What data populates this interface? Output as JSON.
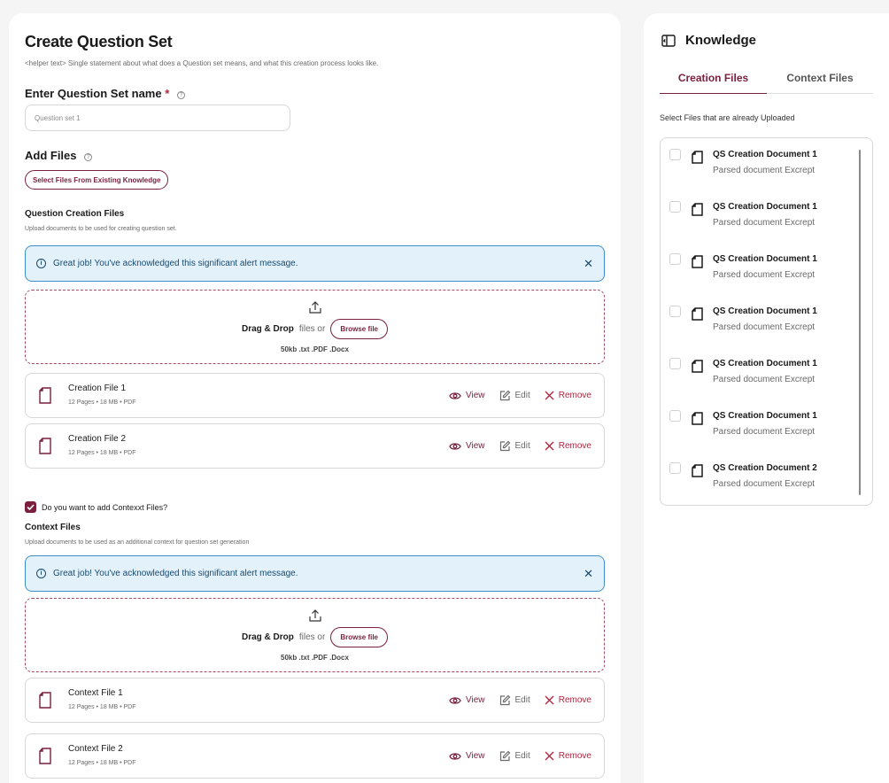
{
  "main": {
    "title": "Create Question Set",
    "helper": "<helper text> Single statement about what does a Question set  means, and what this creation process looks like.",
    "name_label": "Enter Question Set name",
    "required_mark": "*",
    "name_value": "Question set 1",
    "add_files_label": "Add Files",
    "select_existing_btn": "Select Files From Existing Knowledge",
    "creation_section": {
      "title": "Question Creation Files",
      "subtitle": "Upload documents to be used for creating question set.",
      "alert": "Great job! You've acknowledged this significant alert message.",
      "drop_label": "Drag & Drop",
      "drop_or": "files or",
      "browse": "Browse file",
      "formats": "50kb .txt .PDF .Docx",
      "files": [
        {
          "name": "Creation File 1",
          "meta": "12 Pages  •  18 MB  •  PDF"
        },
        {
          "name": "Creation File 2",
          "meta": "12 Pages  •  18 MB  •  PDF"
        }
      ]
    },
    "context_checkbox": "Do you want to add Contexxt Files?",
    "context_section": {
      "title": "Context Files",
      "subtitle": "Upload documents to be used as an additional context for question set generation",
      "alert": "Great job! You've acknowledged this significant alert message.",
      "drop_label": "Drag & Drop",
      "drop_or": "files or",
      "browse": "Browse file",
      "formats": "50kb .txt .PDF .Docx",
      "files": [
        {
          "name": "Context File 1",
          "meta": "12 Pages  •  18 MB  •  PDF"
        },
        {
          "name": "Context File 2",
          "meta": "12 Pages  •  18 MB  •  PDF"
        }
      ]
    },
    "actions": {
      "view": "View",
      "edit": "Edit",
      "remove": "Remove"
    }
  },
  "sidebar": {
    "title": "Knowledge",
    "tabs": [
      {
        "label": "Creation Files",
        "active": true
      },
      {
        "label": "Context Files",
        "active": false
      }
    ],
    "list_label": "Select Files that are already Uploaded",
    "docs": [
      {
        "title": "QS Creation Document 1",
        "sub": "Parsed document Excrept"
      },
      {
        "title": "QS Creation Document 1",
        "sub": "Parsed document Excrept"
      },
      {
        "title": "QS Creation Document 1",
        "sub": "Parsed document Excrept"
      },
      {
        "title": "QS Creation Document 1",
        "sub": "Parsed document Excrept"
      },
      {
        "title": "QS Creation Document 1",
        "sub": "Parsed document Excrept"
      },
      {
        "title": "QS Creation Document 1",
        "sub": "Parsed document Excrept"
      },
      {
        "title": "QS Creation Document 2",
        "sub": "Parsed document Excrept"
      }
    ]
  },
  "colors": {
    "brand": "#7a1f3d",
    "alert_bg": "#e3f1fb",
    "alert_border": "#3d8ec9",
    "danger": "#b0263e"
  }
}
